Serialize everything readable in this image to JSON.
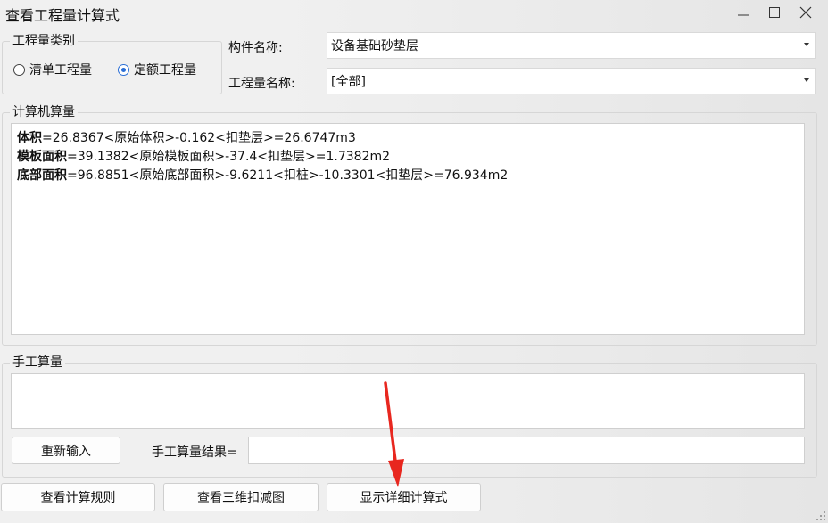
{
  "window": {
    "title": "查看工程量计算式"
  },
  "category": {
    "legend": "工程量类别",
    "options": [
      {
        "label": "清单工程量",
        "checked": false
      },
      {
        "label": "定额工程量",
        "checked": true
      }
    ]
  },
  "component": {
    "label": "构件名称:",
    "value": "设备基础砂垫层"
  },
  "quantity": {
    "label": "工程量名称:",
    "value": "[全部]"
  },
  "computer": {
    "legend": "计算机算量",
    "lines": [
      {
        "name": "体积",
        "expr": "=26.8367<原始体积>-0.162<扣垫层>=26.6747m3"
      },
      {
        "name": "模板面积",
        "expr": "=39.1382<原始模板面积>-37.4<扣垫层>=1.7382m2"
      },
      {
        "name": "底部面积",
        "expr": "=96.8851<原始底部面积>-9.6211<扣桩>-10.3301<扣垫层>=76.934m2"
      }
    ]
  },
  "manual": {
    "legend": "手工算量",
    "reenter_label": "重新输入",
    "result_label": "手工算量结果=",
    "result_value": ""
  },
  "buttons": {
    "rules": "查看计算规则",
    "view3d": "查看三维扣减图",
    "detail": "显示详细计算式"
  },
  "colors": {
    "annotation_arrow": "#e8271f",
    "radio_accent": "#2b6fd6"
  }
}
